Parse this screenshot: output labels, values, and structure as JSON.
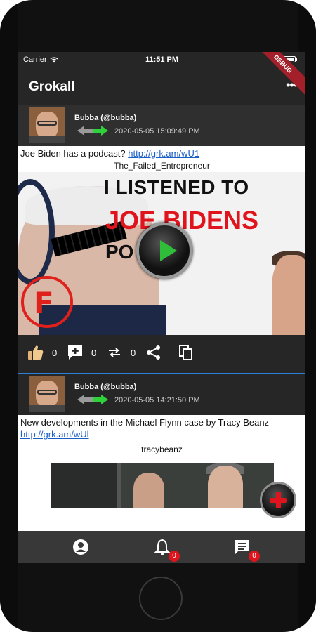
{
  "status_bar": {
    "carrier": "Carrier",
    "time": "11:51 PM",
    "battery_level": 1.0
  },
  "app_bar": {
    "title": "Grokall",
    "more_label": "•••",
    "debug_banner": "DEBUG"
  },
  "posts": [
    {
      "author": "Bubba (@bubba)",
      "timestamp": "2020-05-05 15:09:49 PM",
      "text": "Joe Biden has a podcast?",
      "link": "http://grk.am/wU1",
      "source": "The_Failed_Entrepreneur",
      "thumbnail": {
        "line1": "I LISTENED TO",
        "line2": "JOE BIDENS",
        "line3": "PO    ST",
        "mark": "F"
      },
      "actions": {
        "likes": "0",
        "comments": "0",
        "reposts": "0"
      }
    },
    {
      "author": "Bubba (@bubba)",
      "timestamp": "2020-05-05 14:21:50 PM",
      "text": "New developments in the Michael Flynn case by Tracy Beanz",
      "link": "http://grk.am/wUl",
      "source": "tracybeanz"
    }
  ],
  "bottom_nav": {
    "notifications_badge": "0",
    "messages_badge": "0"
  },
  "colors": {
    "accent_blue": "#2b7fd6",
    "badge_red": "#e0141c",
    "play_green": "#2fbd3a"
  },
  "icons": [
    "wifi-icon",
    "more-icon",
    "repost-arrows-icon",
    "play-icon",
    "thumbs-up-icon",
    "comment-add-icon",
    "repost-icon",
    "share-icon",
    "copy-icon",
    "add-icon",
    "profile-icon",
    "bell-icon",
    "chat-icon"
  ]
}
